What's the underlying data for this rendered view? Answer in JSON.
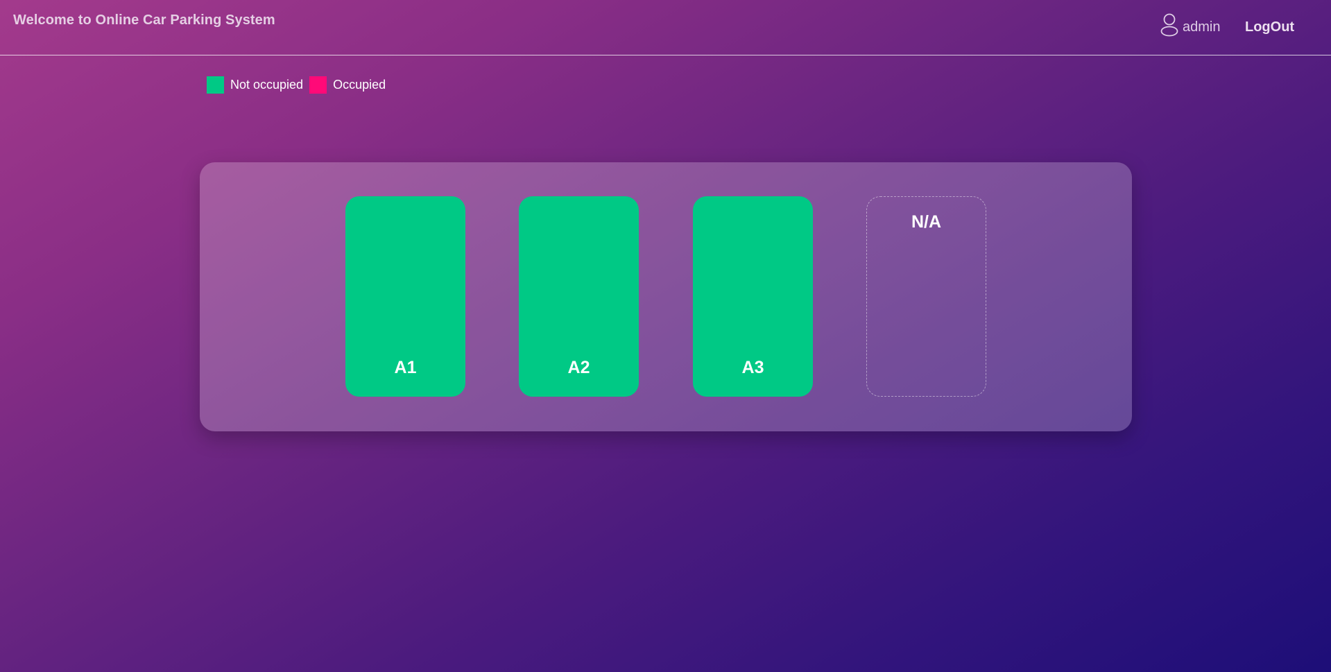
{
  "header": {
    "title": "Welcome to Online Car Parking System",
    "user_icon": "user-icon",
    "username": "admin",
    "logout_label": "LogOut"
  },
  "legend": {
    "items": [
      {
        "label": "Not occupied",
        "color": "#00c985"
      },
      {
        "label": "Occupied",
        "color": "#ff0a78"
      }
    ]
  },
  "parking": {
    "slots": [
      {
        "label": "A1",
        "status": "not-occupied",
        "color": "#00c985"
      },
      {
        "label": "A2",
        "status": "not-occupied",
        "color": "#00c985"
      },
      {
        "label": "A3",
        "status": "not-occupied",
        "color": "#00c985"
      },
      {
        "label": "N/A",
        "status": "unavailable"
      }
    ]
  }
}
